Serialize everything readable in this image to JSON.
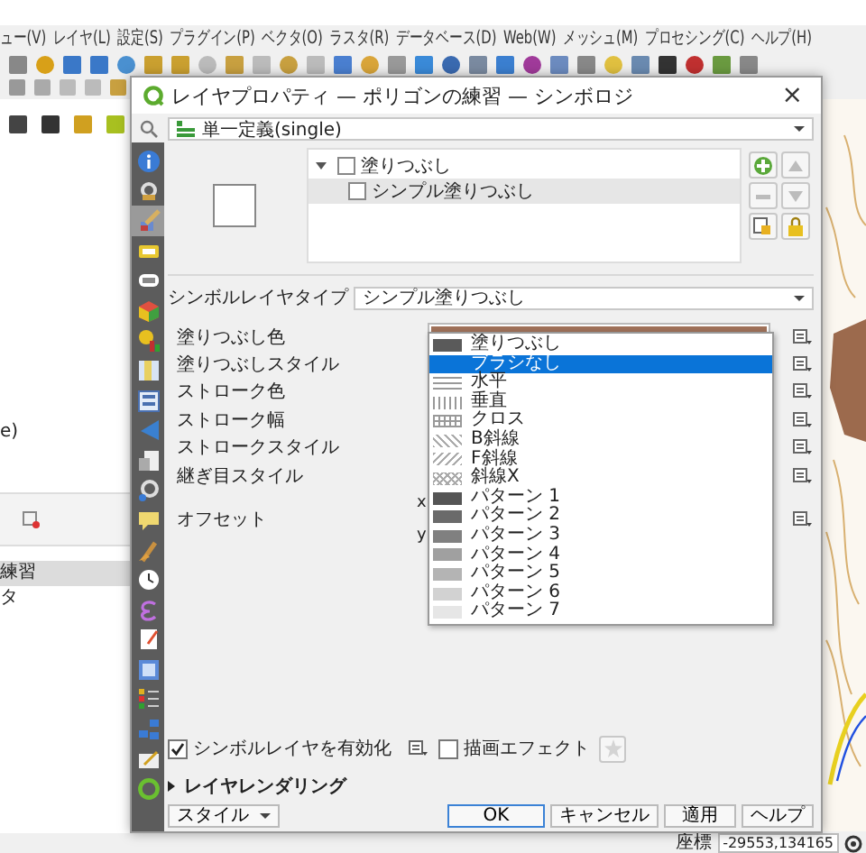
{
  "main_window": {
    "menu": [
      "ュー(V)",
      "レイヤ(L)",
      "設定(S)",
      "プラグイン(P)",
      "ベクタ(O)",
      "ラスタ(R)",
      "データベース(D)",
      "Web(W)",
      "メッシュ(M)",
      "プロセシング(C)",
      "ヘルプ(H)"
    ],
    "panel_fragment": "e)",
    "layer_items": [
      {
        "label": "練習",
        "selected": true
      },
      {
        "label": "タ",
        "selected": false
      }
    ],
    "status_bar": {
      "label": "座標",
      "value": "-29553,134165"
    }
  },
  "dialog": {
    "title": "レイヤプロパティ — ポリゴンの練習 — シンボロジ",
    "close": "×",
    "renderer": "単一定義(single)",
    "tabs": [
      {
        "kind": "info",
        "selected": false
      },
      {
        "kind": "source",
        "selected": false
      },
      {
        "kind": "symbology",
        "selected": true
      },
      {
        "kind": "labels",
        "selected": false
      },
      {
        "kind": "masks",
        "selected": false
      },
      {
        "kind": "scene",
        "selected": false
      },
      {
        "kind": "diagrams",
        "selected": false
      },
      {
        "kind": "fields",
        "selected": false
      },
      {
        "kind": "form",
        "selected": false
      },
      {
        "kind": "joins",
        "selected": false
      },
      {
        "kind": "storage",
        "selected": false
      },
      {
        "kind": "actions",
        "selected": false
      },
      {
        "kind": "display",
        "selected": false
      },
      {
        "kind": "rendering",
        "selected": false
      },
      {
        "kind": "temporal",
        "selected": false
      },
      {
        "kind": "variables",
        "selected": false
      },
      {
        "kind": "metadata",
        "selected": false
      },
      {
        "kind": "dependencies",
        "selected": false
      },
      {
        "kind": "legend",
        "selected": false
      },
      {
        "kind": "server",
        "selected": false
      },
      {
        "kind": "digitizing",
        "selected": false
      },
      {
        "kind": "elevation",
        "selected": false
      }
    ],
    "symbol_tree": [
      {
        "label": "塗りつぶし",
        "expanded": true,
        "selected": false,
        "children": [
          {
            "label": "シンプル塗りつぶし",
            "selected": true
          }
        ]
      }
    ],
    "symbol_tools": [
      {
        "kind": "add",
        "disabled": false
      },
      {
        "kind": "up",
        "disabled": true
      },
      {
        "kind": "remove",
        "disabled": true
      },
      {
        "kind": "down",
        "disabled": true
      },
      {
        "kind": "duplicate",
        "disabled": false
      },
      {
        "kind": "lock",
        "disabled": false
      }
    ],
    "symbol_layer_type": {
      "label": "シンボルレイヤタイプ",
      "value": "シンプル塗りつぶし"
    },
    "properties": [
      {
        "label": "塗りつぶし色",
        "color": "#a0725a"
      },
      {
        "label": "塗りつぶしスタイル"
      },
      {
        "label": "ストローク色"
      },
      {
        "label": "ストローク幅"
      },
      {
        "label": "ストロークスタイル"
      },
      {
        "label": "継ぎ目スタイル"
      },
      {
        "label": "オフセット",
        "axes": [
          "x",
          "y"
        ]
      }
    ],
    "style_dropdown": [
      {
        "label": "塗りつぶし",
        "kind": "solid",
        "selected": false
      },
      {
        "label": "ブラシなし",
        "kind": "none",
        "selected": true
      },
      {
        "label": "水平",
        "kind": "horizontal",
        "selected": false
      },
      {
        "label": "垂直",
        "kind": "vertical",
        "selected": false
      },
      {
        "label": "クロス",
        "kind": "cross",
        "selected": false
      },
      {
        "label": "B斜線",
        "kind": "bdiag",
        "selected": false
      },
      {
        "label": "F斜線",
        "kind": "fdiag",
        "selected": false
      },
      {
        "label": "斜線X",
        "kind": "diagcross",
        "selected": false
      },
      {
        "label": "パターン 1",
        "kind": "dense1",
        "selected": false
      },
      {
        "label": "パターン 2",
        "kind": "dense2",
        "selected": false
      },
      {
        "label": "パターン 3",
        "kind": "dense3",
        "selected": false
      },
      {
        "label": "パターン 4",
        "kind": "dense4",
        "selected": false
      },
      {
        "label": "パターン 5",
        "kind": "dense5",
        "selected": false
      },
      {
        "label": "パターン 6",
        "kind": "dense6",
        "selected": false
      },
      {
        "label": "パターン 7",
        "kind": "dense7",
        "selected": false
      }
    ],
    "enable_layer": {
      "label": "シンボルレイヤを有効化",
      "checked": true
    },
    "draw_effects": {
      "label": "描画エフェクト",
      "checked": false
    },
    "layer_rendering": {
      "label": "レイヤレンダリング",
      "expanded": false
    },
    "style_menu": "スタイル",
    "buttons": [
      "OK",
      "キャンセル",
      "適用",
      "ヘルプ"
    ]
  }
}
